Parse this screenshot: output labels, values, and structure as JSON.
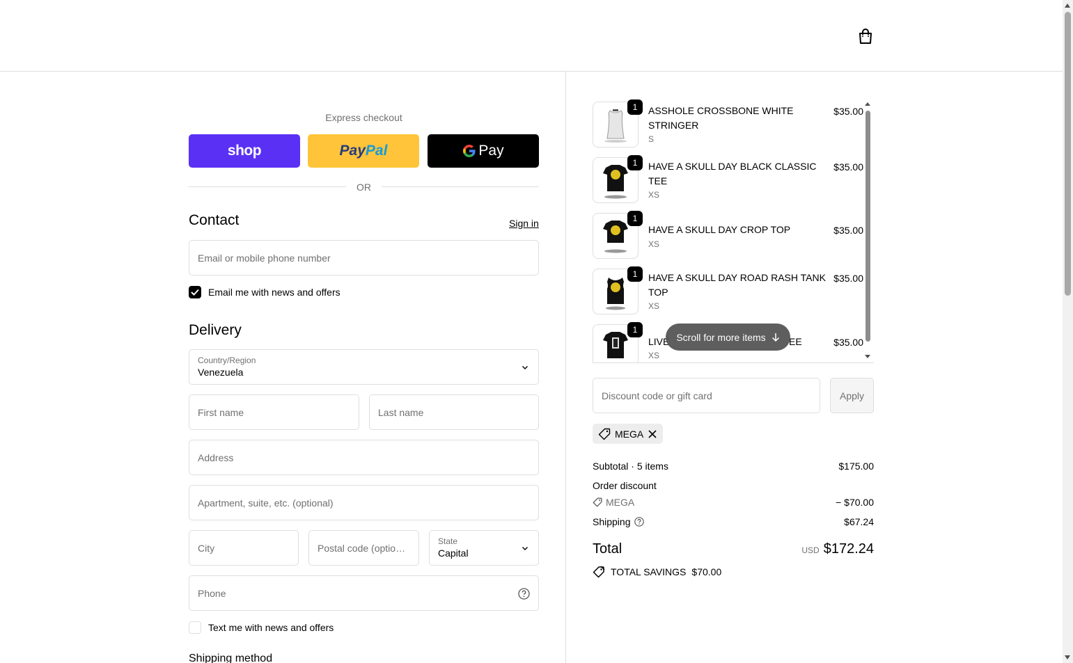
{
  "express": {
    "label": "Express checkout",
    "shop_label": "shop",
    "paypal_label_1": "Pay",
    "paypal_label_2": "Pal",
    "gpay_label": "Pay",
    "or": "OR"
  },
  "contact": {
    "title": "Contact",
    "sign_in": "Sign in",
    "email_placeholder": "Email or mobile phone number",
    "news_label": "Email me with news and offers",
    "news_checked": true
  },
  "delivery": {
    "title": "Delivery",
    "country_label": "Country/Region",
    "country_value": "Venezuela",
    "first_name": "First name",
    "last_name": "Last name",
    "address": "Address",
    "apartment": "Apartment, suite, etc. (optional)",
    "city": "City",
    "postal": "Postal code (optional)",
    "state_label": "State",
    "state_value": "Capital",
    "phone": "Phone",
    "text_label": "Text me with news and offers",
    "shipping_method": "Shipping method"
  },
  "cart": {
    "items": [
      {
        "name": "ASSHOLE CROSSBONE WHITE STRINGER",
        "variant": "S",
        "price": "$35.00",
        "qty": "1"
      },
      {
        "name": "HAVE A SKULL DAY BLACK CLASSIC TEE",
        "variant": "XS",
        "price": "$35.00",
        "qty": "1"
      },
      {
        "name": "HAVE A SKULL DAY CROP TOP",
        "variant": "XS",
        "price": "$35.00",
        "qty": "1"
      },
      {
        "name": "HAVE A SKULL DAY ROAD RASH TANK TOP",
        "variant": "XS",
        "price": "$35.00",
        "qty": "1"
      },
      {
        "name": "LIVE",
        "name_tail": "EE",
        "variant": "XS",
        "price": "$35.00",
        "qty": "1"
      }
    ],
    "scroll_hint": "Scroll for more items"
  },
  "discount": {
    "placeholder": "Discount code or gift card",
    "apply": "Apply",
    "applied_code": "MEGA"
  },
  "summary": {
    "subtotal_label": "Subtotal",
    "items_count": "5 items",
    "subtotal": "$175.00",
    "order_discount_label": "Order discount",
    "discount_code": "MEGA",
    "discount_amount": "− $70.00",
    "shipping_label": "Shipping",
    "shipping": "$67.24",
    "total_label": "Total",
    "currency": "USD",
    "total": "$172.24",
    "savings_label": "TOTAL SAVINGS",
    "savings": "$70.00"
  },
  "colors": {
    "shop": "#5a31f4",
    "paypal": "#ffc439",
    "gpay": "#000000"
  }
}
